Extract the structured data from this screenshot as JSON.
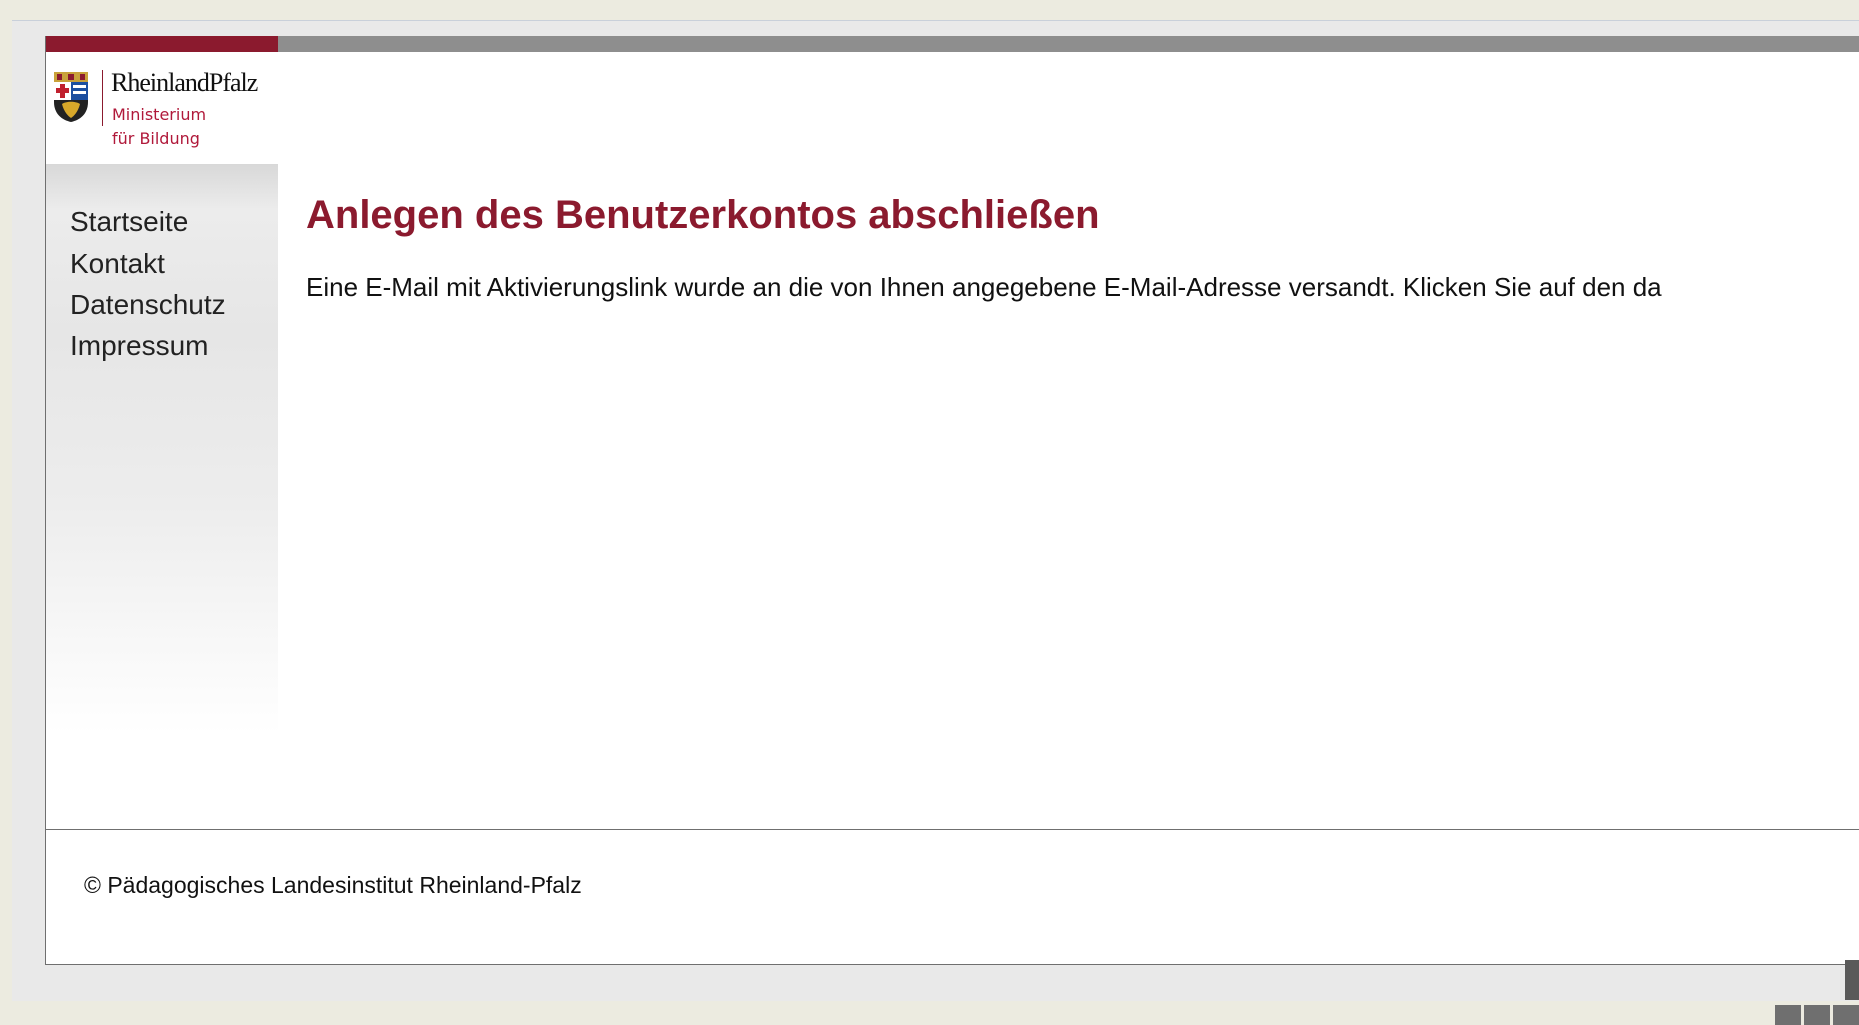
{
  "header": {
    "logo": {
      "title": "RheinlandPfalz",
      "subtitle_line1": "Ministerium",
      "subtitle_line2": "für Bildung",
      "icon": "coat-of-arms-icon"
    }
  },
  "sidebar": {
    "items": [
      {
        "label": "Startseite"
      },
      {
        "label": "Kontakt"
      },
      {
        "label": "Datenschutz"
      },
      {
        "label": "Impressum"
      }
    ]
  },
  "main": {
    "title": "Anlegen des Benutzerkontos abschließen",
    "message": "Eine E-Mail mit Aktivierungslink wurde an die von Ihnen angegebene E-Mail-Adresse versandt. Klicken Sie auf den da"
  },
  "footer": {
    "copyright": "© Pädagogisches Landesinstitut Rheinland-Pfalz"
  },
  "colors": {
    "brand_red": "#8b1a2e",
    "topbar_grey": "#8e8e8e",
    "background": "#ecebe0"
  }
}
